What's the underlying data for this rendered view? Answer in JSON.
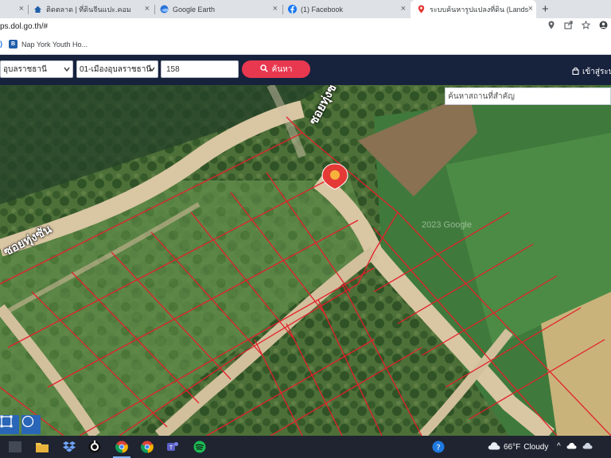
{
  "browser": {
    "tabs": [
      {
        "title": "",
        "icon": "blank-tab-icon"
      },
      {
        "title": "ติดตลาด | ที่ดินจีนแปะ.คอม",
        "icon": "home-icon"
      },
      {
        "title": "Google Earth",
        "icon": "google-earth-icon"
      },
      {
        "title": "(1) Facebook",
        "icon": "facebook-icon"
      },
      {
        "title": "ระบบค้นหารูปแปลงที่ดิน (LandsMaps)",
        "icon": "map-pin-icon",
        "active": true
      }
    ],
    "new_tab_label": "+",
    "close_glyph": "×",
    "url": "ps.dol.go.th/#",
    "bookmarks": [
      {
        "label": "Nap York Youth Ho...",
        "badge": "B"
      }
    ],
    "bookmark_prefix": ")"
  },
  "app": {
    "province_select": "อุบลราชธานี",
    "district_select": "01-เมืองอุบลราชธานี",
    "parcel_number": "158",
    "search_button": "ค้นหา",
    "login_label": "เข้าสู่ระบบ"
  },
  "map": {
    "place_search_placeholder": "ค้นหาสถานที่สำคัญ",
    "road_labels": [
      "ซอยทุ่งซัน",
      "ซอยทุ่งซ"
    ],
    "watermark": "2023 Google"
  },
  "taskbar": {
    "weather_temp": "66°F",
    "weather_text": "Cloudy",
    "tray_chevron": "^"
  },
  "colors": {
    "header_bg": "#17223d",
    "search_button": "#e8384f",
    "parcel_lines": "#e3202b",
    "marker": "#e53935"
  }
}
